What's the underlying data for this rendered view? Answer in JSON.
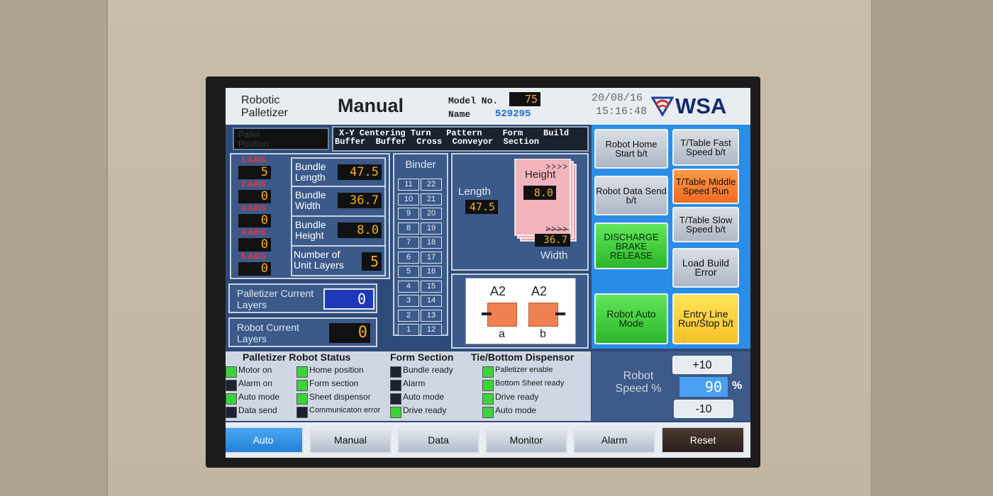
{
  "header": {
    "app_line1": "Robotic",
    "app_line2": "Palletizer",
    "mode_title": "Manual",
    "model_label": "Model No.",
    "model_value": "75",
    "name_label": "Name",
    "name_value": "529295",
    "date": "20/08/16",
    "time": "15:16:48",
    "logo_text": "WSA"
  },
  "top_strip": {
    "left_box": "Pallet\nPosition",
    "row1": "X-Y Centering Turn   Pattern    Form    Build",
    "row2": "Buffer  Buffer  Cross  Conveyor  Section"
  },
  "axes": [
    {
      "label": "1 AXIS",
      "value": "5"
    },
    {
      "label": "2 AXIS",
      "value": "0"
    },
    {
      "label": "3 AXIS",
      "value": "0"
    },
    {
      "label": "4 AXIS",
      "value": "0"
    },
    {
      "label": "5 AXIS",
      "value": "0"
    }
  ],
  "bundle": {
    "length_label": "Bundle Length",
    "length_value": "47.5",
    "width_label": "Bundle Width",
    "width_value": "36.7",
    "height_label": "Bundle Height",
    "height_value": "8.0",
    "layers_label": "Number of Unit Layers",
    "layers_value": "5"
  },
  "binder": {
    "title": "Binder",
    "left": [
      "11",
      "10",
      "9",
      "8",
      "7",
      "6",
      "5",
      "4",
      "3",
      "2",
      "1"
    ],
    "right": [
      "22",
      "21",
      "20",
      "19",
      "18",
      "17",
      "16",
      "15",
      "14",
      "13",
      "12"
    ]
  },
  "dimensions": {
    "length_label": "Length",
    "length_value": "47.5",
    "height_label": "Height",
    "height_value": "8.0",
    "width_label": "Width",
    "width_value": "36.7"
  },
  "counters": {
    "palletizer_label": "Palletizer Current Layers",
    "palletizer_value": "0",
    "robot_label": "Robot Current Layers",
    "robot_value": "0"
  },
  "a2": {
    "left_title": "A2",
    "right_title": "A2",
    "left_sub": "a",
    "right_sub": "b"
  },
  "right_buttons": {
    "robot_home": "Robot Home Start b/t",
    "robot_data": "Robot Data Send b/t",
    "discharge": "DISCHARGE BRAKE RELEASE",
    "robot_auto": "Robot Auto Mode",
    "tt_fast": "T/Table Fast Speed b/t",
    "tt_middle": "T/Table Middle Speed Run",
    "tt_slow": "T/Table Slow Speed b/t",
    "load_build": "Load Build Error",
    "entry_line": "Entry Line Run/Stop b/t"
  },
  "status": {
    "palletizer_robot_title": "Palletizer Robot Status",
    "form_section_title": "Form Section",
    "tie_title": "Tie/Bottom Dispensor",
    "col1": [
      {
        "text": "Motor on",
        "on": true
      },
      {
        "text": "Alarm on",
        "on": false
      },
      {
        "text": "Auto mode",
        "on": true
      },
      {
        "text": "Data send",
        "on": false
      }
    ],
    "col2": [
      {
        "text": "Home position",
        "on": true
      },
      {
        "text": "Form section",
        "on": true
      },
      {
        "text": "Sheet dispensor",
        "on": true
      },
      {
        "text": "Communicaton error",
        "on": false
      }
    ],
    "col3": [
      {
        "text": "Bundle ready",
        "on": false
      },
      {
        "text": "Alarm",
        "on": false
      },
      {
        "text": "Auto mode",
        "on": false
      },
      {
        "text": "Drive ready",
        "on": true
      }
    ],
    "col4": [
      {
        "text": "Palletizer enable",
        "on": true
      },
      {
        "text": "Bottom Sheet ready",
        "on": true
      },
      {
        "text": "Drive ready",
        "on": true
      },
      {
        "text": "Auto mode",
        "on": true
      }
    ]
  },
  "speed": {
    "label": "Robot Speed %",
    "plus": "+10",
    "value": "90",
    "unit": "%",
    "minus": "-10"
  },
  "tabs": [
    "Auto",
    "Manual",
    "Data",
    "Monitor",
    "Alarm",
    "Reset"
  ],
  "colors": {
    "screen_bg": "#2e4a78",
    "active_tab": "#2f8fe0",
    "led_on": "#3ad43a",
    "digit": "#f0b020"
  }
}
